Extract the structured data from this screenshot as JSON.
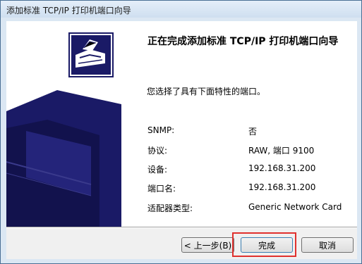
{
  "window": {
    "title": "添加标准 TCP/IP 打印机端口向导"
  },
  "page": {
    "heading": "正在完成添加标准 TCP/IP 打印机端口向导",
    "summary": "您选择了具有下面特性的端口。"
  },
  "properties": [
    {
      "label": "SNMP:",
      "value": "否"
    },
    {
      "label": "协议:",
      "value": "RAW, 端口 9100"
    },
    {
      "label": "设备:",
      "value": "192.168.31.200"
    },
    {
      "label": "端口名:",
      "value": "192.168.31.200"
    },
    {
      "label": "适配器类型:",
      "value": "Generic Network Card"
    }
  ],
  "buttons": {
    "back": "< 上一步(B)",
    "finish": "完成",
    "cancel": "取消"
  },
  "colors": {
    "sidebar_navy": "#1a1a66",
    "highlight_red": "#e0312e"
  },
  "icons": {
    "wizard_graphic": "printer-icon"
  }
}
